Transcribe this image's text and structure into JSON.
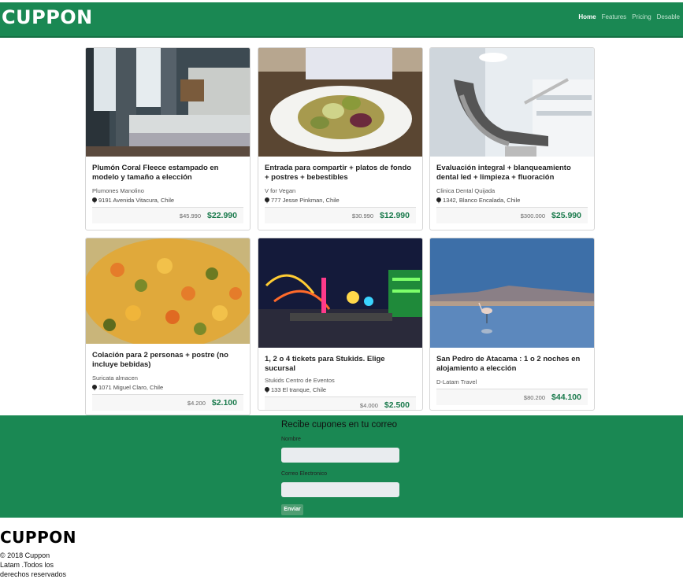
{
  "brand": {
    "logo": "CUPPON",
    "primary_color": "#1a8853",
    "price_color": "#1a7a4c"
  },
  "nav": {
    "items": [
      {
        "label": "Home",
        "active": true
      },
      {
        "label": "Features",
        "active": false
      },
      {
        "label": "Pricing",
        "active": false
      },
      {
        "label": "Desable",
        "active": false
      }
    ]
  },
  "deals": [
    {
      "title": "Plumón Coral Fleece estampado en modelo y tamaño a elección",
      "merchant": "Plumones Manolino",
      "address": "9191 Avenida Vitacura, Chile",
      "old_price": "$45.990",
      "new_price": "$22.990",
      "image": "bedroom-photo"
    },
    {
      "title": "Entrada para compartir + platos de fondo + postres + bebestibles",
      "merchant": "V for Vegan",
      "address": "777 Jesse Pinkman, Chile",
      "old_price": "$30.990",
      "new_price": "$12.990",
      "image": "vegan-salad-photo"
    },
    {
      "title": "Evaluación integral + blanqueamiento dental led + limpieza + fluoración",
      "merchant": "Clinica Dental Quijada",
      "address": "1342, Blanco Encalada, Chile",
      "old_price": "$300.000",
      "new_price": "$25.990",
      "image": "dental-chair-photo"
    },
    {
      "title": "Colación para 2 personas + postre (no incluye bebidas)",
      "merchant": "Suricata almacen",
      "address": "1071 Miguel Claro, Chile",
      "old_price": "$4.200",
      "new_price": "$2.100",
      "image": "curry-food-photo"
    },
    {
      "title": "1, 2 o 4 tickets para Stukids. Elige sucursal",
      "merchant": "Stukids Centro de Eventos",
      "address": "133 El tranque, Chile",
      "old_price": "$4.000",
      "new_price": "$2.500",
      "image": "amusement-park-photo"
    },
    {
      "title": "San Pedro de Atacama : 1 o 2 noches en alojamiento a elección",
      "merchant": "D-Latam Travel",
      "address": "",
      "old_price": "$80.200",
      "new_price": "$44.100",
      "image": "flamingo-lake-photo"
    }
  ],
  "subscribe": {
    "heading": "Recibe cupones en tu correo",
    "name_label": "Nombre",
    "email_label": "Correo Electronico",
    "button_label": "Enviar"
  },
  "footer": {
    "logo": "CUPPON",
    "copyright": "© 2018 Cuppon Latam .Todos los derechos reservados"
  }
}
